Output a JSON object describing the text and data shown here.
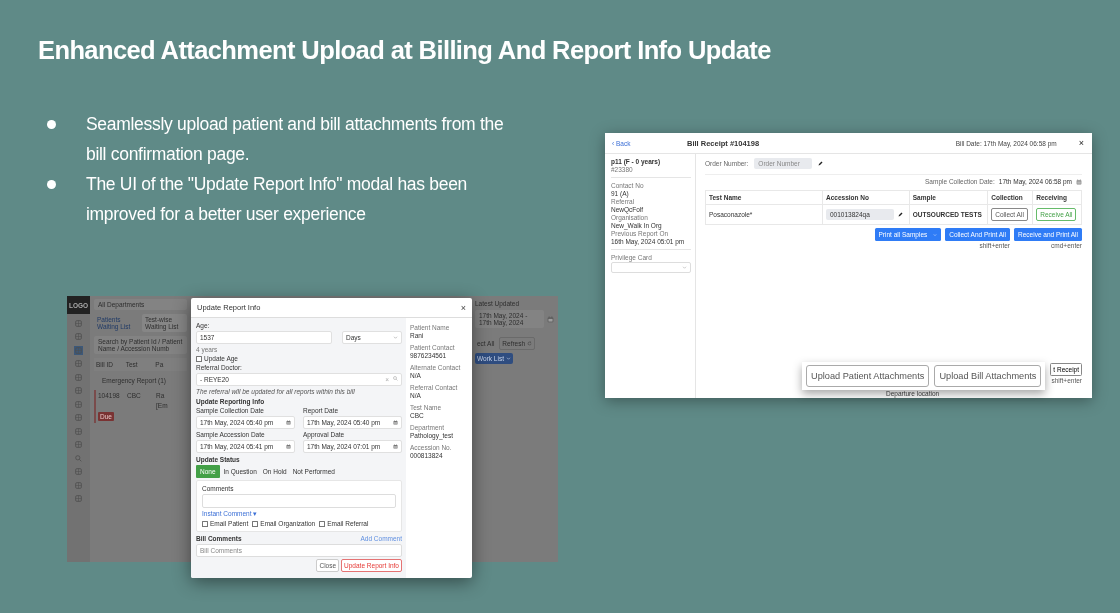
{
  "slide": {
    "title": "Enhanced Attachment Upload at Billing And Report Info Update",
    "bullets": [
      "Seamlessly upload patient and bill attachments from the bill confirmation page.",
      "The UI of the \"Update Report Info\" modal has been improved for a better user experience"
    ]
  },
  "background_app": {
    "logo": "LOGO",
    "department": "All Departments",
    "latest_updated_label": "Latest Updated",
    "date_range": "17th May, 2024 - 17th May, 2024",
    "tabs": [
      {
        "label": "Patients Waiting List",
        "selected": true
      },
      {
        "label": "Test-wise Waiting List",
        "selected": false
      }
    ],
    "search": {
      "placeholder": "Search by Patient Id / Patient Name / Accession Numb"
    },
    "toolbar": [
      "ect All",
      "Refresh",
      "Work List"
    ],
    "columns": [
      "Bill ID",
      "Test",
      "Pa"
    ],
    "group": "Emergency Report (1)",
    "row": {
      "bill_id": "104198",
      "test": "CBC",
      "patient": "Ra",
      "patient_line_2": "[Em",
      "badge": "Due"
    }
  },
  "report_modal": {
    "title": "Update Report Info",
    "close": "×",
    "age_label": "Age:",
    "age_value": "1537",
    "age_unit": "Days",
    "age_hint": "4 years",
    "update_age": {
      "label": "Update Age",
      "checked": false
    },
    "referral_label": "Referral Doctor:",
    "referral_value": "- REYE20",
    "referral_clear": "×",
    "referral_note": "The referral will be updated for all reports within this bill",
    "section_title": "Update Reporting Info",
    "dates": [
      {
        "label": "Sample Collection Date",
        "value": "17th May, 2024 05:40 pm"
      },
      {
        "label": "Report Date",
        "value": "17th May, 2024 05:40 pm"
      },
      {
        "label": "Sample Accession Date",
        "value": "17th May, 2024 05:41 pm"
      },
      {
        "label": "Approval Date",
        "value": "17th May, 2024 07:01 pm"
      }
    ],
    "status_title": "Update Status",
    "statuses": [
      {
        "label": "None",
        "selected": true
      },
      {
        "label": "In Question",
        "selected": false
      },
      {
        "label": "On Hold",
        "selected": false
      },
      {
        "label": "Not Performed",
        "selected": false
      }
    ],
    "comments_label": "Comments",
    "instant_comment": "Instant Comment ▾",
    "emails": [
      {
        "label": "Email Patient",
        "checked": false
      },
      {
        "label": "Email Organization",
        "checked": false
      },
      {
        "label": "Email Referral",
        "checked": false
      }
    ],
    "bill_comments_title": "Bill Comments",
    "add_comment": "Add Comment",
    "bill_comments_placeholder": "Bill Comments",
    "buttons": [
      "Close",
      "Update Report Info"
    ],
    "info": [
      {
        "label": "Patient Name",
        "value": "Rani"
      },
      {
        "label": "Patient Contact",
        "value": "9876234561"
      },
      {
        "label": "Alternate Contact",
        "value": "N/A"
      },
      {
        "label": "Referral Contact",
        "value": "N/A"
      },
      {
        "label": "Test Name",
        "value": "CBC"
      },
      {
        "label": "Department",
        "value": "Pathology_test"
      },
      {
        "label": "Accession No.",
        "value": "000813824"
      }
    ]
  },
  "bill_receipt": {
    "back": "‹ Back",
    "title": "Bill Receipt #104198",
    "bill_date": "Bill Date: 17th May, 2024 06:58 pm",
    "close": "×",
    "patient": "p11 (F - 0 years)",
    "patient_id": "#23380",
    "details": [
      {
        "label": "Contact No",
        "value": "91 (A)"
      },
      {
        "label": "Referral",
        "value": "NewQcFolf"
      },
      {
        "label": "Organisation",
        "value": "New_Walk In Org"
      },
      {
        "label": "Previous Report On",
        "value": "16th May, 2024 05:01 pm"
      }
    ],
    "privilege_label": "Privilege Card",
    "order_label": "Order Number:",
    "order_placeholder": "Order Number",
    "collection_label": "Sample Collection Date:",
    "collection_value": "17th May, 2024 06:58 pm",
    "columns": [
      "Test Name",
      "Accession No",
      "Sample",
      "Collection",
      "Receiving"
    ],
    "row": {
      "test": "Posaconazole*",
      "accession": "001013824qa",
      "sample": "OUTSOURCED TESTS",
      "collect": "Collect All",
      "receive": "Receive All"
    },
    "actions": [
      {
        "label": "Print all Samples"
      },
      {
        "label": "Collect And Print All",
        "shortcut": "shift+enter"
      },
      {
        "label": "Receive and Print All",
        "shortcut": "cmd+enter"
      }
    ],
    "footer_button": "t Receipt",
    "footer_shortcut": "shift+enter",
    "footer_note": "Departure location"
  },
  "upload_buttons": [
    "Upload Patient Attachments",
    "Upload Bill Attachments"
  ]
}
